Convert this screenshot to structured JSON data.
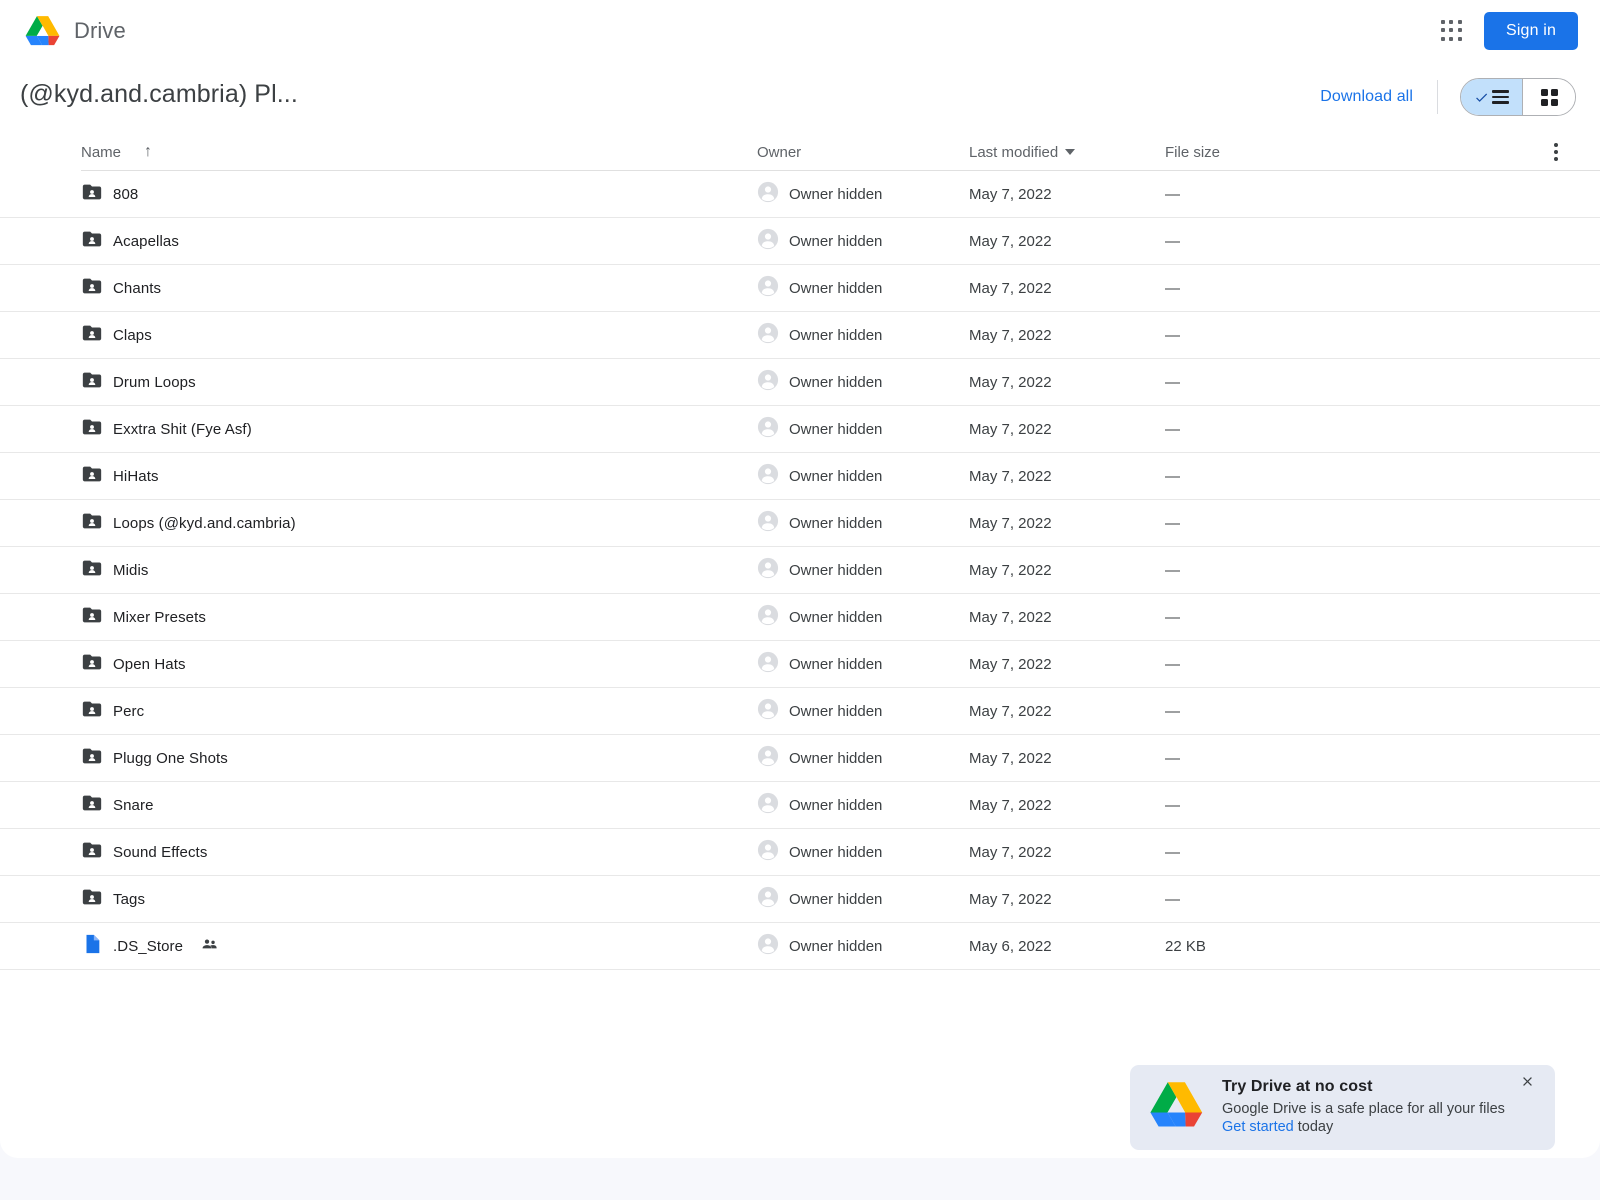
{
  "app": {
    "brand_name": "Drive",
    "logo_icon": "google-drive-logo",
    "apps_icon": "apps-grid-icon",
    "sign_in_label": "Sign in"
  },
  "subheader": {
    "folder_title": "(@kyd.and.cambria) Pl...",
    "download_all_label": "Download all",
    "view_list_icon": "list-view-icon",
    "view_grid_icon": "grid-view-icon",
    "active_view": "list"
  },
  "table": {
    "columns": {
      "name": "Name",
      "owner": "Owner",
      "last_modified": "Last modified",
      "file_size": "File size"
    },
    "sort": {
      "column": "Name",
      "direction_icon": "arrow-up-icon",
      "modified_caret_icon": "caret-down-icon"
    },
    "more_options_icon": "kebab-menu-icon",
    "rows": [
      {
        "name": "808",
        "icon": "shared-folder-icon",
        "shared": false,
        "owner": "Owner hidden",
        "modified": "May 7, 2022",
        "size": "—"
      },
      {
        "name": "Acapellas",
        "icon": "shared-folder-icon",
        "shared": false,
        "owner": "Owner hidden",
        "modified": "May 7, 2022",
        "size": "—"
      },
      {
        "name": "Chants",
        "icon": "shared-folder-icon",
        "shared": false,
        "owner": "Owner hidden",
        "modified": "May 7, 2022",
        "size": "—"
      },
      {
        "name": "Claps",
        "icon": "shared-folder-icon",
        "shared": false,
        "owner": "Owner hidden",
        "modified": "May 7, 2022",
        "size": "—"
      },
      {
        "name": "Drum Loops",
        "icon": "shared-folder-icon",
        "shared": false,
        "owner": "Owner hidden",
        "modified": "May 7, 2022",
        "size": "—"
      },
      {
        "name": "Exxtra Shit (Fye Asf)",
        "icon": "shared-folder-icon",
        "shared": false,
        "owner": "Owner hidden",
        "modified": "May 7, 2022",
        "size": "—"
      },
      {
        "name": "HiHats",
        "icon": "shared-folder-icon",
        "shared": false,
        "owner": "Owner hidden",
        "modified": "May 7, 2022",
        "size": "—"
      },
      {
        "name": "Loops (@kyd.and.cambria)",
        "icon": "shared-folder-icon",
        "shared": false,
        "owner": "Owner hidden",
        "modified": "May 7, 2022",
        "size": "—"
      },
      {
        "name": "Midis",
        "icon": "shared-folder-icon",
        "shared": false,
        "owner": "Owner hidden",
        "modified": "May 7, 2022",
        "size": "—"
      },
      {
        "name": "Mixer Presets",
        "icon": "shared-folder-icon",
        "shared": false,
        "owner": "Owner hidden",
        "modified": "May 7, 2022",
        "size": "—"
      },
      {
        "name": "Open Hats",
        "icon": "shared-folder-icon",
        "shared": false,
        "owner": "Owner hidden",
        "modified": "May 7, 2022",
        "size": "—"
      },
      {
        "name": "Perc",
        "icon": "shared-folder-icon",
        "shared": false,
        "owner": "Owner hidden",
        "modified": "May 7, 2022",
        "size": "—"
      },
      {
        "name": "Plugg One Shots",
        "icon": "shared-folder-icon",
        "shared": false,
        "owner": "Owner hidden",
        "modified": "May 7, 2022",
        "size": "—"
      },
      {
        "name": "Snare",
        "icon": "shared-folder-icon",
        "shared": false,
        "owner": "Owner hidden",
        "modified": "May 7, 2022",
        "size": "—"
      },
      {
        "name": "Sound Effects",
        "icon": "shared-folder-icon",
        "shared": false,
        "owner": "Owner hidden",
        "modified": "May 7, 2022",
        "size": "—"
      },
      {
        "name": "Tags",
        "icon": "shared-folder-icon",
        "shared": false,
        "owner": "Owner hidden",
        "modified": "May 7, 2022",
        "size": "—"
      },
      {
        "name": ".DS_Store",
        "icon": "document-file-icon",
        "shared": true,
        "owner": "Owner hidden",
        "modified": "May 6, 2022",
        "size": "22 KB"
      }
    ]
  },
  "toast": {
    "logo_icon": "google-drive-logo",
    "title": "Try Drive at no cost",
    "body": "Google Drive is a safe place for all your files",
    "link": "Get started",
    "link_suffix": " today",
    "close_icon": "close-icon"
  },
  "colors": {
    "accent_blue": "#1a73e8",
    "folder_gray": "#3c4043",
    "doc_blue": "#1a73e8",
    "toast_bg": "#e6eaf3",
    "page_bg": "#f7f8fc"
  }
}
